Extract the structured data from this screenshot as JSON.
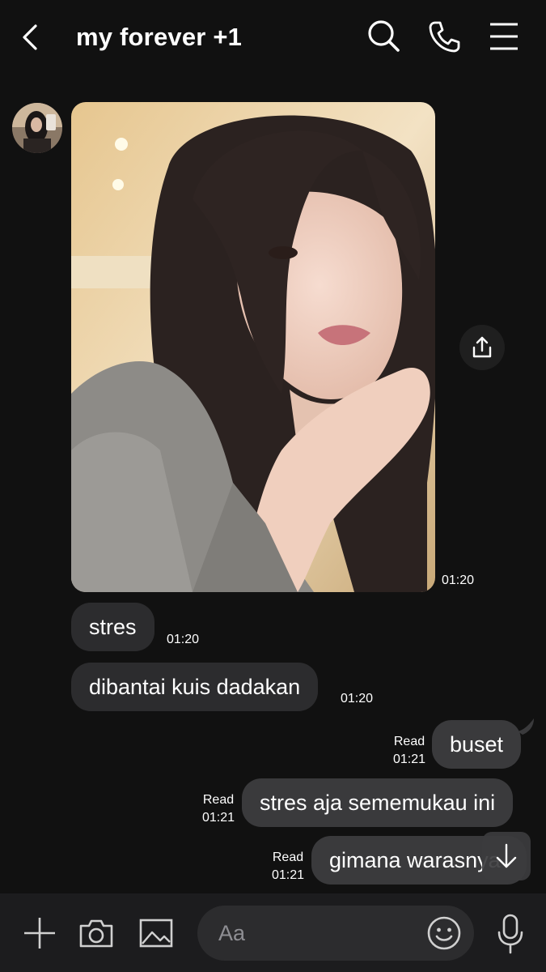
{
  "header": {
    "title": "my forever +1",
    "back_icon": "chevron-left-icon",
    "search_icon": "search-icon",
    "phone_icon": "phone-icon",
    "menu_icon": "menu-icon"
  },
  "messages": [
    {
      "type": "image",
      "from": "them",
      "time": "01:20"
    },
    {
      "type": "text",
      "from": "them",
      "text": "stres",
      "time": "01:20"
    },
    {
      "type": "text",
      "from": "them",
      "text": "dibantai kuis dadakan",
      "time": "01:20"
    },
    {
      "type": "text",
      "from": "me",
      "text": "buset",
      "read": "Read",
      "time": "01:21"
    },
    {
      "type": "text",
      "from": "me",
      "text": "stres aja sememukau ini",
      "read": "Read",
      "time": "01:21"
    },
    {
      "type": "text",
      "from": "me",
      "text": "gimana warasnya",
      "read": "Read",
      "time": "01:21"
    }
  ],
  "composer": {
    "placeholder": "Aa",
    "plus_icon": "plus-icon",
    "camera_icon": "camera-icon",
    "gallery_icon": "image-icon",
    "emoji_icon": "emoji-icon",
    "mic_icon": "microphone-icon"
  },
  "colors": {
    "background": "#111111",
    "bubble_them": "#2c2c2e",
    "bubble_me": "#3a3a3c",
    "bottom_bar": "#1c1c1e"
  }
}
